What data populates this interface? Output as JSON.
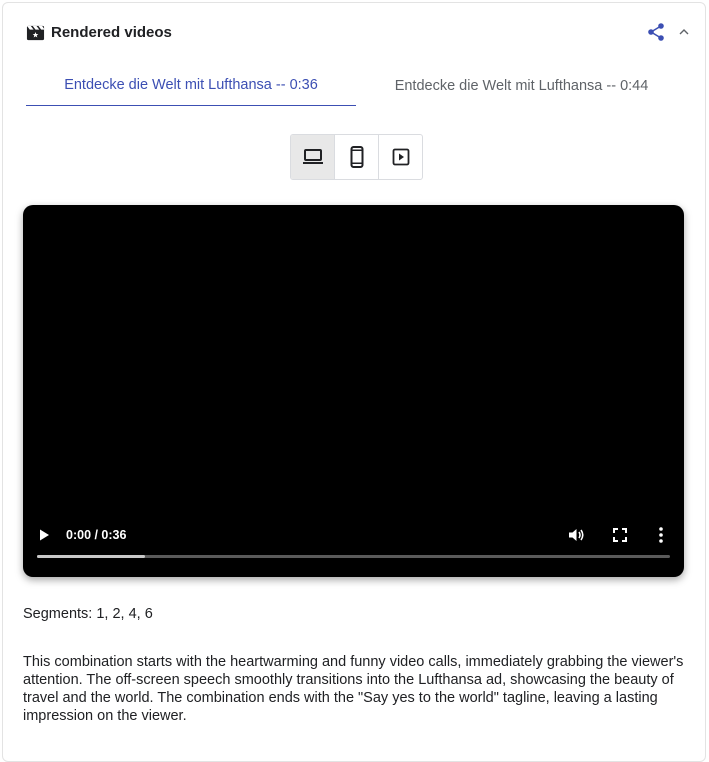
{
  "header": {
    "title": "Rendered videos",
    "icons": [
      "clapperboard-icon",
      "share-icon",
      "chevron-up-icon"
    ]
  },
  "tabs": [
    {
      "label": "Entdecke die Welt mit Lufthansa -- 0:36",
      "selected": true
    },
    {
      "label": "Entdecke die Welt mit Lufthansa -- 0:44",
      "selected": false
    }
  ],
  "device_toggle": {
    "options": [
      "laptop-icon",
      "phone-icon",
      "play-box-icon"
    ],
    "selected": "laptop-icon"
  },
  "video_player": {
    "time": "0:00 / 0:36",
    "buffered_fraction": 0.17,
    "icons": [
      "play-icon",
      "volume-icon",
      "fullscreen-icon",
      "more-vert-icon"
    ]
  },
  "segments": "Segments: 1, 2, 4, 6",
  "description": "This combination starts with the heartwarming and funny video calls, immediately grabbing the viewer's attention. The off-screen speech smoothly transitions into the Lufthansa ad, showcasing the beauty of travel and the world. The combination ends with the \"Say yes to the world\" tagline, leaving a lasting impression on the viewer.",
  "colors": {
    "accent": "#3c4fb3",
    "tab_inactive": "#5f6368",
    "video_bg": "#000000"
  }
}
